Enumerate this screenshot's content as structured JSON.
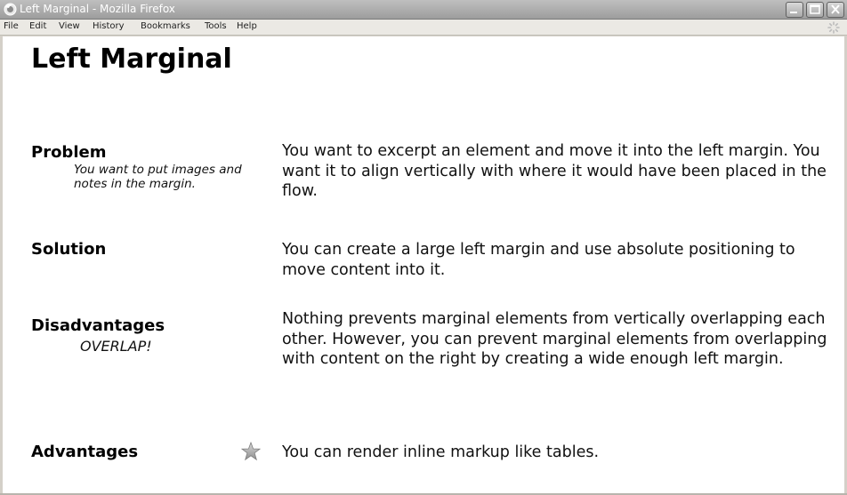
{
  "window": {
    "title": "Left Marginal - Mozilla Firefox"
  },
  "menu": {
    "items": [
      "File",
      "Edit",
      "View",
      "History",
      "Bookmarks",
      "Tools",
      "Help"
    ]
  },
  "page": {
    "title": "Left Marginal",
    "sections": [
      {
        "label": "Problem",
        "note": "You want to put images and notes in the margin.",
        "description": "You want to excerpt an element and move it into the left margin. You want it to align vertically with where it would have been placed in the flow."
      },
      {
        "label": "Solution",
        "note": "",
        "description": "You can create a large left margin and use absolute positioning to move content into it."
      },
      {
        "label": "Disadvantages",
        "note": "OVERLAP!",
        "description": "Nothing prevents marginal elements from vertically overlapping each other. However, you can prevent marginal elements from overlapping with content on the right by creating a wide enough left margin."
      },
      {
        "label": "Advantages",
        "note": "",
        "icon": "star-icon",
        "description": "You can render inline markup like tables."
      }
    ]
  },
  "colors": {
    "titlebar": "#9d9d9d",
    "content_background": "#ffffff",
    "chrome": "#d4d0c8"
  }
}
